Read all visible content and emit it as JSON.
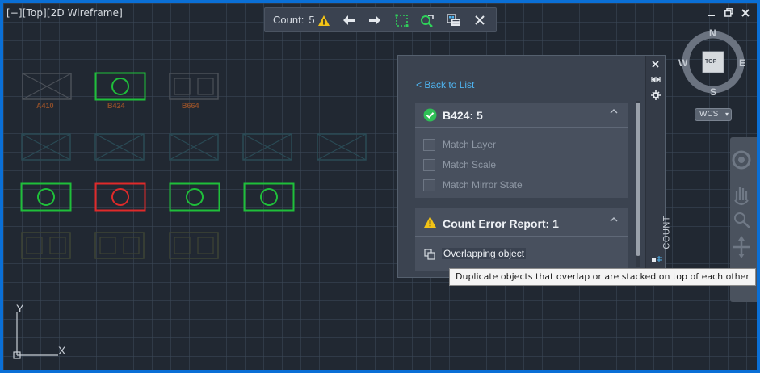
{
  "viewport": {
    "label": "[−][Top][2D Wireframe]"
  },
  "count_toolbar": {
    "label": "Count:",
    "value": "5",
    "icons": [
      "warning-icon",
      "arrow-left-icon",
      "arrow-right-icon",
      "select-objects-icon",
      "zoom-icon",
      "count-table-icon",
      "close-icon"
    ]
  },
  "blocks": {
    "labels": [
      "A410",
      "B424",
      "B664"
    ]
  },
  "palette": {
    "back_link": "< Back to List",
    "block_card": {
      "title": "B424: 5",
      "options": [
        "Match Layer",
        "Match Scale",
        "Match Mirror State"
      ]
    },
    "error_card": {
      "title": "Count Error Report: 1",
      "item": "Overlapping object"
    },
    "side_tab": "COUNT"
  },
  "tooltip": {
    "text": "Duplicate objects that overlap or are stacked on top of each other"
  },
  "viewcube": {
    "n": "N",
    "s": "S",
    "e": "E",
    "w": "W",
    "face": "TOP",
    "wcs": "WCS"
  },
  "ucs": {
    "x": "X",
    "y": "Y"
  },
  "colors": {
    "green": "#1fbf3a",
    "red": "#e02a2a",
    "gray_block": "#4a5058",
    "teal_block": "#2a4a55",
    "accent_link": "#4fb4f0"
  }
}
